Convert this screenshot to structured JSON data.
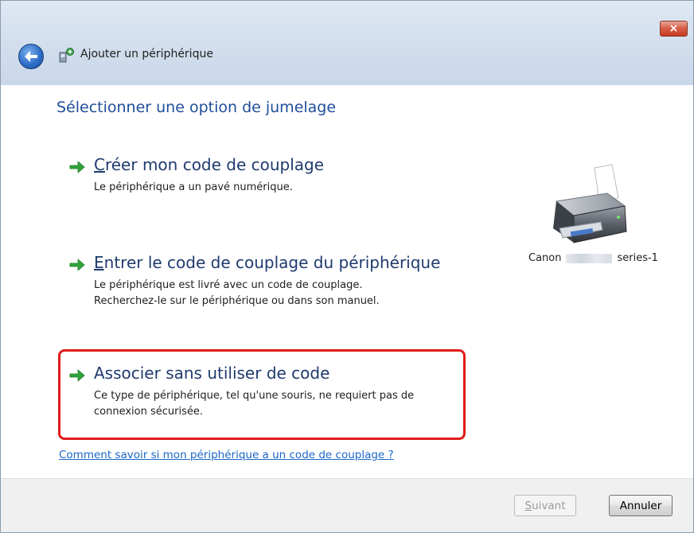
{
  "window": {
    "close_glyph": "×",
    "header_title": "Ajouter un périphérique"
  },
  "main": {
    "instruction": "Sélectionner une option de jumelage",
    "options": [
      {
        "title_access": "C",
        "title_rest": "réer mon code de couplage",
        "desc_lines": [
          "Le périphérique a un pavé numérique."
        ]
      },
      {
        "title_access": "E",
        "title_rest": "ntrer le code de couplage du périphérique",
        "desc_lines": [
          "Le périphérique est livré avec un code de couplage.",
          "Recherchez-le sur le périphérique ou dans son manuel."
        ]
      },
      {
        "title_access": "",
        "title_rest": "Associer sans utiliser de code",
        "desc_lines": [
          "Ce type de périphérique, tel qu'une souris, ne requiert pas de",
          "connexion sécurisée."
        ]
      }
    ],
    "help_link": "Comment savoir si mon périphérique a un code de couplage ?",
    "device": {
      "name_prefix": "Canon",
      "name_suffix": "series-1"
    }
  },
  "footer": {
    "next_access": "S",
    "next_rest": "uivant",
    "cancel": "Annuler"
  },
  "colors": {
    "instruction": "#1f4e9a",
    "option_title": "#1f3a6e",
    "arrow": "#2fa33a",
    "highlight": "#e11b1b",
    "link": "#1a66c9"
  },
  "icons": [
    "close-icon",
    "back-arrow-icon",
    "device-add-icon",
    "green-arrow-icon",
    "printer-icon"
  ]
}
